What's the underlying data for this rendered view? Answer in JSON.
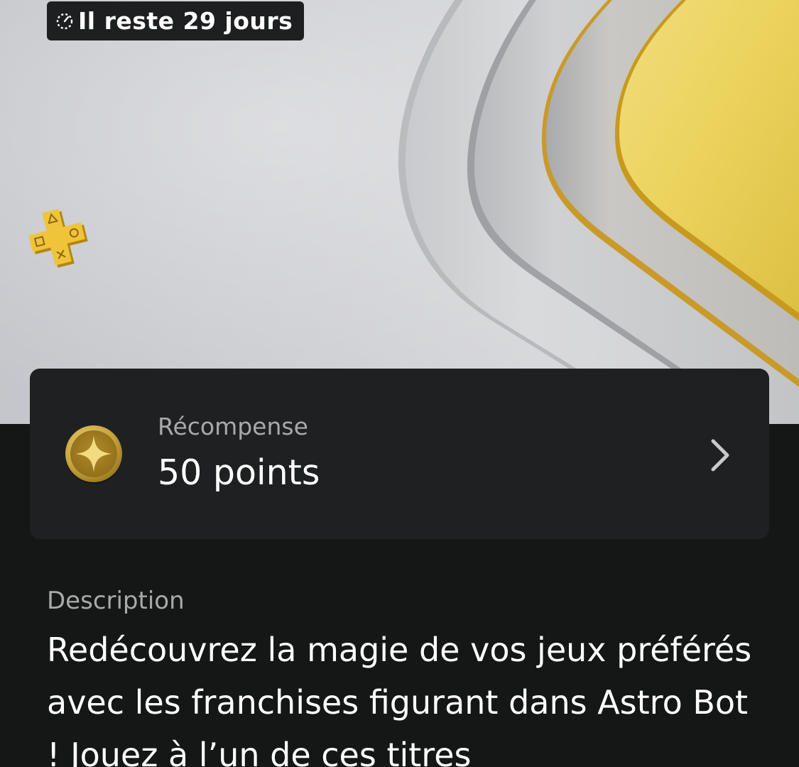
{
  "hero": {
    "badge_text": "Il reste 29 jours",
    "timer_icon": "timer-icon",
    "logo_icon": "playstation-plus-icon"
  },
  "reward": {
    "label": "Récompense",
    "value": "50 points",
    "icon": "reward-coin-icon",
    "chevron_icon": "chevron-right-icon"
  },
  "description": {
    "heading": "Description",
    "text": "Redécouvrez la magie de vos jeux préférés avec les franchises figurant dans Astro Bot ! Jouez à l’un de ces titres"
  },
  "colors": {
    "background": "#151616",
    "card": "#1f2021",
    "accent_gold": "#e8c24a",
    "text_primary": "#ffffff",
    "text_secondary": "#a8a9ab"
  }
}
